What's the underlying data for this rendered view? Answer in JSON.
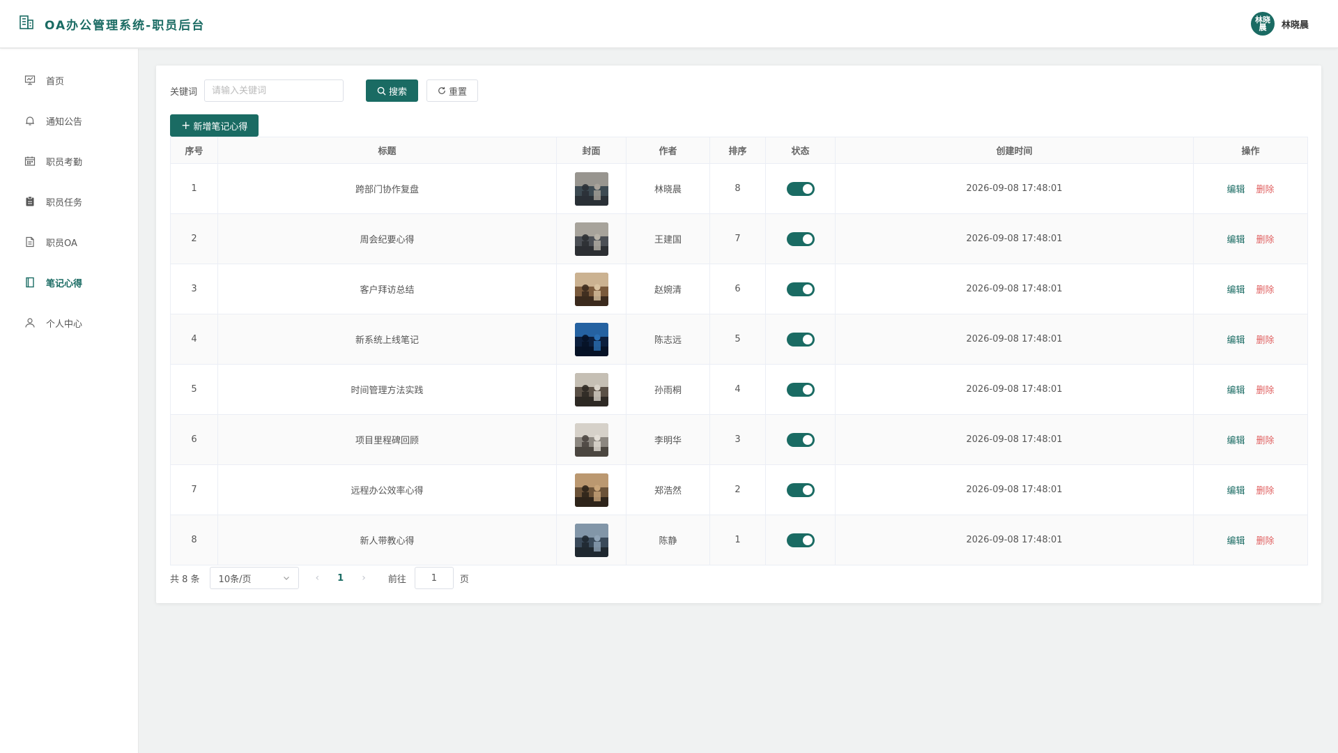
{
  "app": {
    "title": "OA办公管理系统-职员后台",
    "user_name": "林晓晨",
    "avatar_text": "林晓晨",
    "accent_color": "#1a6b63",
    "danger_color": "#e06060"
  },
  "sidebar": {
    "items": [
      {
        "label": "首页",
        "icon": "dashboard-icon"
      },
      {
        "label": "通知公告",
        "icon": "bell-icon"
      },
      {
        "label": "职员考勤",
        "icon": "calendar-icon"
      },
      {
        "label": "职员任务",
        "icon": "clipboard-icon"
      },
      {
        "label": "职员OA",
        "icon": "document-icon"
      },
      {
        "label": "笔记心得",
        "icon": "notebook-icon",
        "active": true
      },
      {
        "label": "个人中心",
        "icon": "user-icon"
      }
    ]
  },
  "search": {
    "label": "关键词",
    "placeholder": "请输入关键词",
    "value": "",
    "search_label": "搜索",
    "reset_label": "重置"
  },
  "actions": {
    "add_label": "新增笔记心得"
  },
  "table": {
    "columns": [
      "序号",
      "标题",
      "封面",
      "作者",
      "排序",
      "状态",
      "创建时间",
      "操作"
    ],
    "edit_label": "编辑",
    "delete_label": "删除",
    "rows": [
      {
        "index": "1",
        "title": "跨部门协作复盘",
        "author": "林晓晨",
        "sort": "8",
        "status": true,
        "created": "2026-09-08 17:48:01",
        "cover_icon": "meeting-photo-icon"
      },
      {
        "index": "2",
        "title": "周会纪要心得",
        "author": "王建国",
        "sort": "7",
        "status": true,
        "created": "2026-09-08 17:48:01",
        "cover_icon": "office-photo-icon"
      },
      {
        "index": "3",
        "title": "客户拜访总结",
        "author": "赵婉清",
        "sort": "6",
        "status": true,
        "created": "2026-09-08 17:48:01",
        "cover_icon": "handshake-photo-icon"
      },
      {
        "index": "4",
        "title": "新系统上线笔记",
        "author": "陈志远",
        "sort": "5",
        "status": true,
        "created": "2026-09-08 17:48:01",
        "cover_icon": "monitors-photo-icon"
      },
      {
        "index": "5",
        "title": "时间管理方法实践",
        "author": "孙雨桐",
        "sort": "4",
        "status": true,
        "created": "2026-09-08 17:48:01",
        "cover_icon": "notebook-photo-icon"
      },
      {
        "index": "6",
        "title": "项目里程碑回顾",
        "author": "李明华",
        "sort": "3",
        "status": true,
        "created": "2026-09-08 17:48:01",
        "cover_icon": "presentation-photo-icon"
      },
      {
        "index": "7",
        "title": "远程办公效率心得",
        "author": "郑浩然",
        "sort": "2",
        "status": true,
        "created": "2026-09-08 17:48:01",
        "cover_icon": "desk-photo-icon"
      },
      {
        "index": "8",
        "title": "新人带教心得",
        "author": "陈静",
        "sort": "1",
        "status": true,
        "created": "2026-09-08 17:48:01",
        "cover_icon": "workstation-photo-icon"
      }
    ]
  },
  "pagination": {
    "total_text": "共 8 条",
    "page_size": "10条/页",
    "current_page": "1",
    "goto_label": "前往",
    "goto_value": "1",
    "page_suffix": "页"
  }
}
